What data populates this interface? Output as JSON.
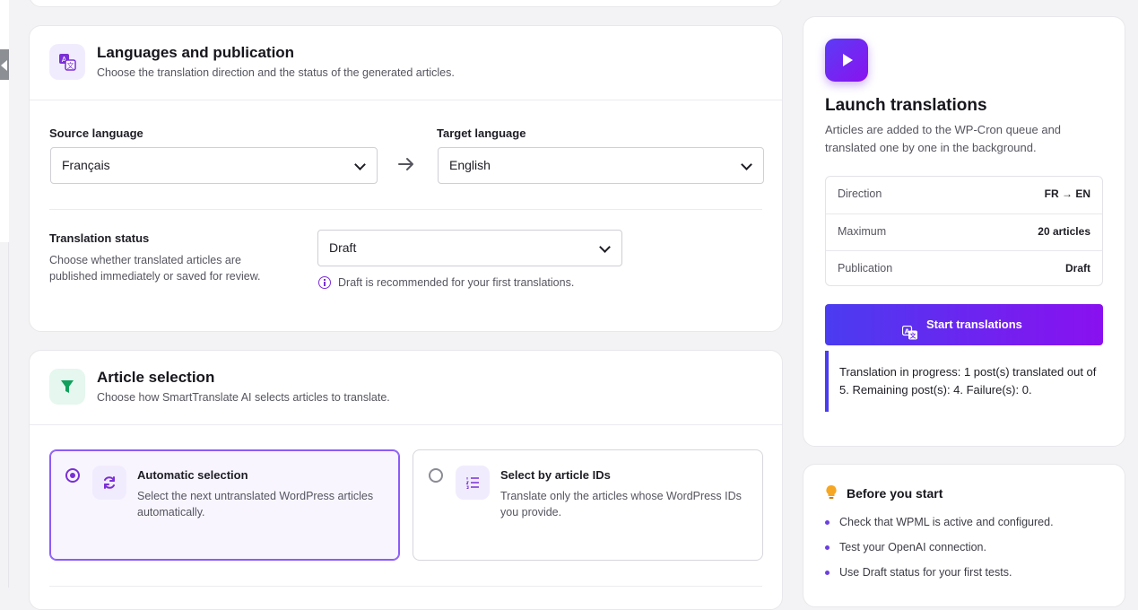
{
  "languages_card": {
    "title": "Languages and publication",
    "subtitle": "Choose the translation direction and the status of the generated articles.",
    "source_label": "Source language",
    "source_value": "Français",
    "target_label": "Target language",
    "target_value": "English",
    "status_label": "Translation status",
    "status_description": "Choose whether translated articles are published immediately or saved for review.",
    "status_value": "Draft",
    "status_hint": "Draft is recommended for your first translations."
  },
  "article_card": {
    "title": "Article selection",
    "subtitle": "Choose how SmartTranslate AI selects articles to translate.",
    "options": [
      {
        "title": "Automatic selection",
        "description": "Select the next untranslated WordPress articles automatically.",
        "selected": true
      },
      {
        "title": "Select by article IDs",
        "description": "Translate only the articles whose WordPress IDs you provide.",
        "selected": false
      }
    ]
  },
  "launch_card": {
    "title": "Launch translations",
    "description": "Articles are added to the WP-Cron queue and translated one by one in the background.",
    "summary": [
      {
        "key": "Direction",
        "value": "FR → EN"
      },
      {
        "key": "Maximum",
        "value": "20 articles"
      },
      {
        "key": "Publication",
        "value": "Draft"
      }
    ],
    "button_label": "Start translations",
    "progress_text": "Translation in progress: 1 post(s) translated out of 5. Remaining post(s): 4. Failure(s): 0."
  },
  "before_card": {
    "title": "Before you start",
    "tips": [
      "Check that WPML is active and configured.",
      "Test your OpenAI connection.",
      "Use Draft status for your first tests."
    ]
  },
  "colors": {
    "accent": "#7b2fd6",
    "gradient_start": "#4a3cf0",
    "gradient_end": "#8a10f0",
    "success_icon": "#12a05c"
  },
  "icons": {
    "languages_header": "translate-icon",
    "article_header": "filter-icon",
    "auto_option": "refresh-icon",
    "ids_option": "list-icon",
    "launch": "play-icon",
    "before": "lightbulb-icon"
  }
}
